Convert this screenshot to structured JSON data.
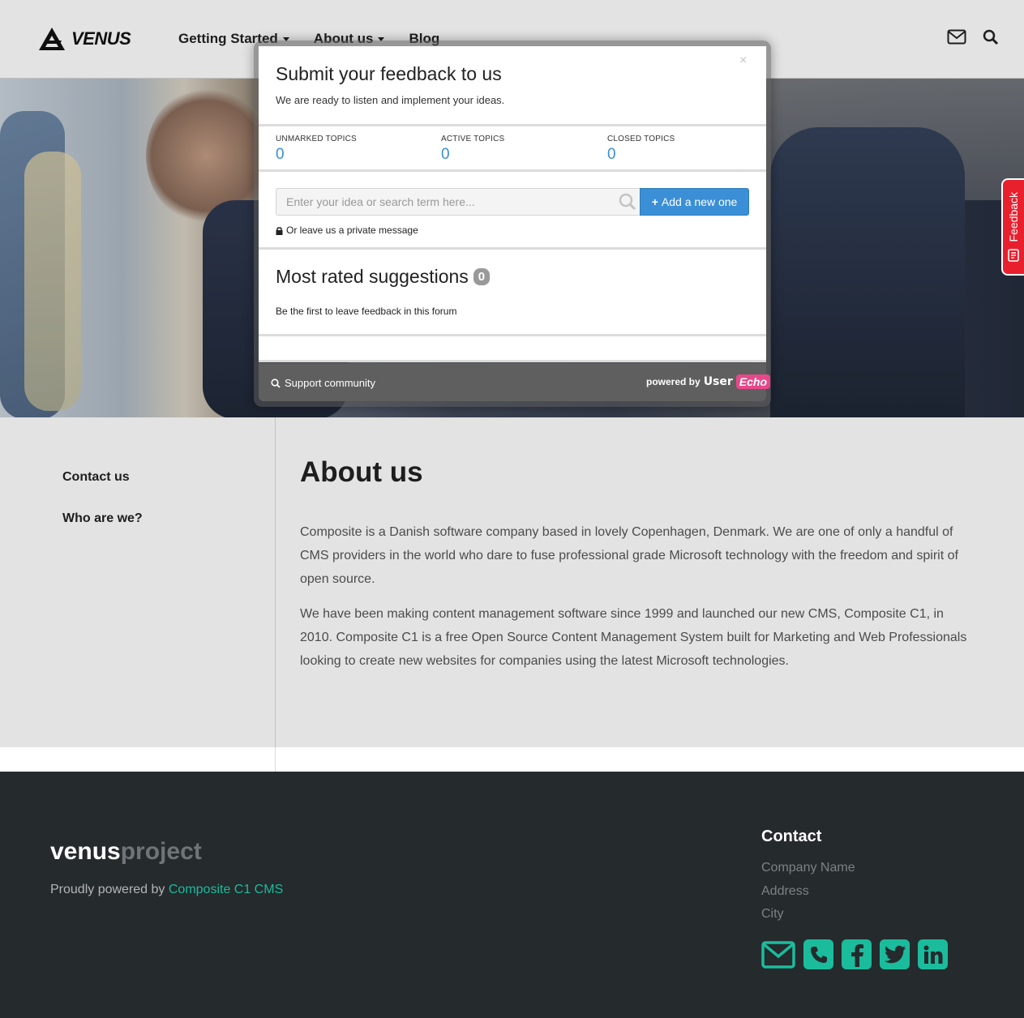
{
  "header": {
    "brand": "VENUS",
    "nav": [
      {
        "label": "Getting Started",
        "dropdown": true
      },
      {
        "label": "About us",
        "dropdown": true
      },
      {
        "label": "Blog",
        "dropdown": false
      }
    ]
  },
  "sidebar": {
    "items": [
      "Contact us",
      "Who are we?"
    ]
  },
  "main": {
    "title": "About us",
    "paragraphs": [
      "Composite is a Danish software company based in lovely Copenhagen, Denmark. We are one of only a handful of CMS providers in the world who dare to fuse professional grade Microsoft technology with the freedom and spirit of open source.",
      "We have been making content management software since 1999 and launched our new CMS, Composite C1, in 2010. Composite C1 is a free Open Source Content Management System built for Marketing and Web Professionals looking to create new websites for companies using the latest Microsoft technologies."
    ]
  },
  "footer": {
    "brand_a": "venus",
    "brand_b": "project",
    "powered_prefix": "Proudly powered by ",
    "powered_link": "Composite C1 CMS",
    "contact_title": "Contact",
    "contact_lines": [
      "Company Name",
      "Address",
      "City"
    ],
    "social_icons": [
      "mail-icon",
      "phone-icon",
      "facebook-icon",
      "twitter-icon",
      "linkedin-icon"
    ],
    "accent": "#1abc9c"
  },
  "feedback_tab": {
    "label": "Feedback",
    "color": "#e8202e"
  },
  "modal": {
    "close": "×",
    "title": "Submit your feedback to us",
    "subtitle": "We are ready to listen and implement your ideas.",
    "stats": [
      {
        "label": "UNMARKED TOPICS",
        "value": "0"
      },
      {
        "label": "ACTIVE TOPICS",
        "value": "0"
      },
      {
        "label": "CLOSED TOPICS",
        "value": "0"
      }
    ],
    "search_placeholder": "Enter your idea or search term here...",
    "add_button": "Add a new one",
    "private_message": "Or leave us a private message",
    "rated_title": "Most rated suggestions",
    "rated_count": "0",
    "empty_text": "Be the first to leave feedback in this forum",
    "support_link": "Support community",
    "powered_by": "powered by",
    "ue_user": "User",
    "ue_echo": "Echo",
    "accent": "#3a8fd6"
  }
}
